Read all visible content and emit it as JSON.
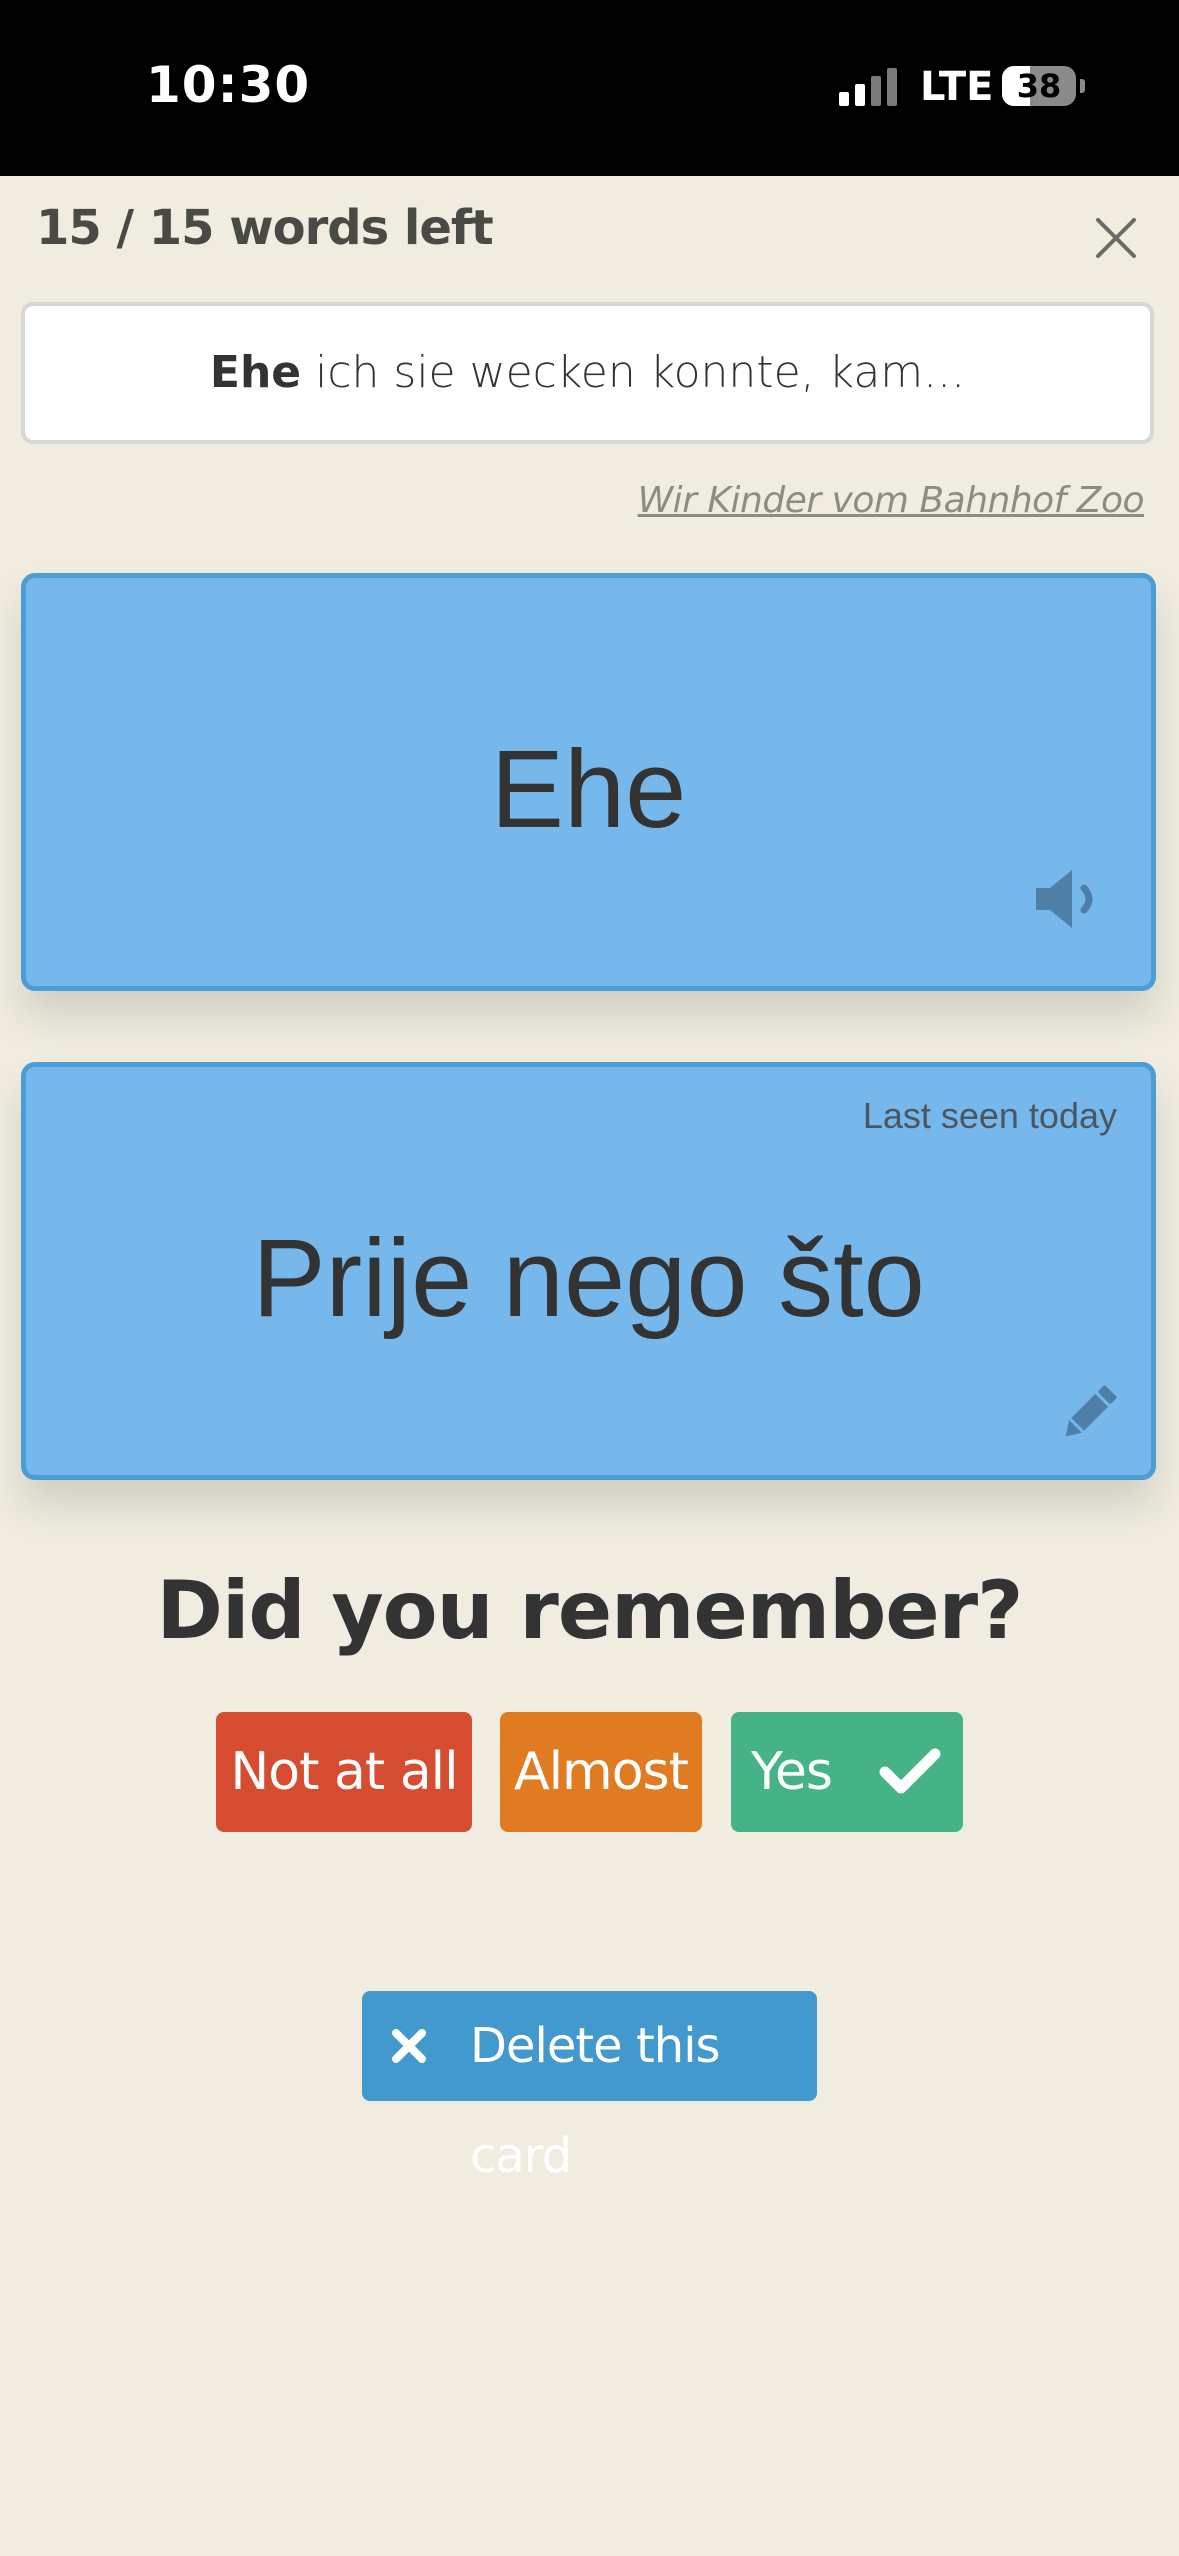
{
  "status_bar": {
    "time": "10:30",
    "network": "LTE",
    "battery_level": "38",
    "battery_percent": 38,
    "signal_bars_active": 2,
    "signal_bars_total": 4
  },
  "header": {
    "words_left": "15 / 15 words left",
    "close_icon": "close-icon"
  },
  "context": {
    "highlight": "Ehe",
    "rest": " ich sie wecken konnte, kam..."
  },
  "source": {
    "title": "Wir Kinder vom Bahnhof Zoo"
  },
  "front_card": {
    "word": "Ehe",
    "audio_icon": "speaker-icon"
  },
  "back_card": {
    "last_seen": "Last seen today",
    "translation": "Prije nego što",
    "edit_icon": "pencil-icon"
  },
  "review": {
    "question": "Did you remember?",
    "buttons": {
      "not_at_all": "Not at all",
      "almost": "Almost",
      "yes": "Yes"
    },
    "colors": {
      "not_at_all": "#d54c30",
      "almost": "#e07b22",
      "yes": "#45b385"
    }
  },
  "actions": {
    "delete_label": "Delete this card",
    "delete_icon": "x-icon"
  },
  "theme": {
    "background": "#f0ede0",
    "card_blue": "#76b7ec",
    "card_border": "#4b9dd4",
    "delete_blue": "#4199cd"
  }
}
